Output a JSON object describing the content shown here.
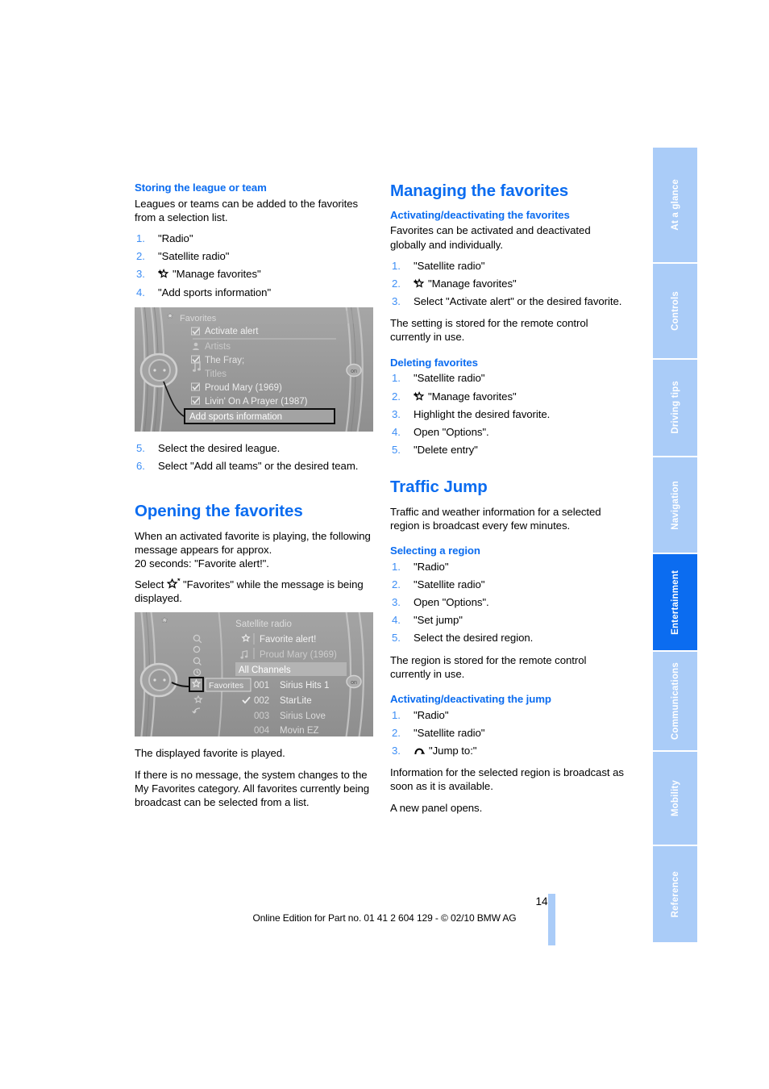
{
  "page": {
    "number": "149",
    "footer_text": "Online Edition for Part no. 01 41 2 604 129 - © 02/10 BMW AG"
  },
  "sidebar": {
    "tabs": [
      {
        "label": "At a glance",
        "active": false
      },
      {
        "label": "Controls",
        "active": false
      },
      {
        "label": "Driving tips",
        "active": false
      },
      {
        "label": "Navigation",
        "active": false
      },
      {
        "label": "Entertainment",
        "active": true
      },
      {
        "label": "Communications",
        "active": false
      },
      {
        "label": "Mobility",
        "active": false
      },
      {
        "label": "Reference",
        "active": false
      }
    ],
    "colors": {
      "inactive_bg": "#aaccf8",
      "active_bg": "#0b6cf0",
      "text": "#ffffff"
    }
  },
  "colors": {
    "heading_blue": "#0b6cf0",
    "step_number_blue": "#3d8ef5",
    "body_black": "#000000",
    "figure_gray": "#9d9d9d"
  },
  "left_column": {
    "section1": {
      "heading": "Storing the league or team",
      "intro": "Leagues or teams can be added to the favorites from a selection list.",
      "steps": [
        {
          "text": "\"Radio\"",
          "icon": null
        },
        {
          "text": "\"Satellite radio\"",
          "icon": null
        },
        {
          "text": "\"Manage favorites\"",
          "icon": "star-plus-icon"
        },
        {
          "text": "\"Add sports information\"",
          "icon": null
        }
      ],
      "steps_after": [
        {
          "text": "Select the desired league.",
          "number": "5."
        },
        {
          "text": "Select \"Add all teams\" or the desired team.",
          "number": "6."
        }
      ]
    },
    "figure1": {
      "name": "idrive-favorites-screen",
      "title": "Favorites",
      "title_icon": "favorites-icon",
      "rows": [
        {
          "icon": "checkbox-checked",
          "label": "Activate alert",
          "separator": true
        },
        {
          "icon": "artist-icon",
          "label": "Artists"
        },
        {
          "icon": "checkbox-checked",
          "label": "The Fray;"
        },
        {
          "icon": "note-icon",
          "label": "Titles"
        },
        {
          "icon": "checkbox-checked",
          "label": "Proud Mary (1969)"
        },
        {
          "icon": "checkbox-checked",
          "label": "Livin' On A Prayer (1987)"
        }
      ],
      "highlighted_row": "Add sports information",
      "right_badge": "on"
    },
    "section2": {
      "heading": "Opening the favorites",
      "paragraphs": [
        "When an activated favorite is playing, the following message appears for approx.\n20 seconds: \"Favorite alert!\".",
        "Select ☆* \"Favorites\" while the message is being displayed."
      ],
      "select_line_prefix": "Select ",
      "select_line_icon": "star-asterisk-icon",
      "select_line_suffix": "\"Favorites\" while the message is being displayed."
    },
    "figure2": {
      "name": "idrive-satellite-radio-screen",
      "title": "Satellite radio",
      "title_icon": "favorites-icon",
      "top_rows": [
        {
          "icon": "star-icon",
          "label": "Favorite alert!"
        },
        {
          "icon": "note-icon",
          "label": "Proud Mary (1969)"
        }
      ],
      "group_header": "All Channels",
      "channels": [
        {
          "num": "001",
          "name": "Sirius Hits 1",
          "checked": false
        },
        {
          "num": "002",
          "name": "StarLite",
          "checked": true
        },
        {
          "num": "003",
          "name": "Sirius Love",
          "checked": false
        },
        {
          "num": "004",
          "name": "Movin EZ",
          "checked": false
        }
      ],
      "tooltip": "Favorites",
      "side_icons": [
        "search-icon",
        "repeat-icon",
        "browse-icon",
        "clock-icon",
        "star-selected-icon",
        "star-plus-icon",
        "back-arrow-icon"
      ],
      "right_badge": "on"
    },
    "section2_after": [
      "The displayed favorite is played.",
      "If there is no message, the system changes to the My Favorites category. All favorites currently being broadcast can be selected from a list."
    ]
  },
  "right_column": {
    "section1": {
      "heading": "Managing the favorites",
      "sub1": {
        "heading": "Activating/deactivating the favorites",
        "intro": "Favorites can be activated and deactivated globally and individually.",
        "steps": [
          {
            "text": "\"Satellite radio\"",
            "icon": null
          },
          {
            "text": "\"Manage favorites\"",
            "icon": "star-plus-icon"
          },
          {
            "text": "Select \"Activate alert\" or the desired favorite.",
            "icon": null
          }
        ],
        "note": "The setting is stored for the remote control currently in use."
      },
      "sub2": {
        "heading": "Deleting favorites",
        "steps": [
          {
            "text": "\"Satellite radio\"",
            "icon": null
          },
          {
            "text": "\"Manage favorites\"",
            "icon": "star-plus-icon"
          },
          {
            "text": "Highlight the desired favorite.",
            "icon": null
          },
          {
            "text": "Open \"Options\".",
            "icon": null
          },
          {
            "text": "\"Delete entry\"",
            "icon": null
          }
        ]
      }
    },
    "section2": {
      "heading": "Traffic Jump",
      "intro": "Traffic and weather information for a selected region is broadcast every few minutes.",
      "sub1": {
        "heading": "Selecting a region",
        "steps": [
          {
            "text": "\"Radio\"",
            "icon": null
          },
          {
            "text": "\"Satellite radio\"",
            "icon": null
          },
          {
            "text": "Open \"Options\".",
            "icon": null
          },
          {
            "text": "\"Set jump\"",
            "icon": null
          },
          {
            "text": "Select the desired region.",
            "icon": null
          }
        ],
        "note": "The region is stored for the remote control currently in use."
      },
      "sub2": {
        "heading": "Activating/deactivating the jump",
        "steps": [
          {
            "text": "\"Radio\"",
            "icon": null
          },
          {
            "text": "\"Satellite radio\"",
            "icon": null
          },
          {
            "text": "\"Jump to:\"",
            "icon": "jump-arc-icon"
          }
        ],
        "note1": "Information for the selected region is broadcast as soon as it is available.",
        "note2": "A new panel opens."
      }
    }
  }
}
